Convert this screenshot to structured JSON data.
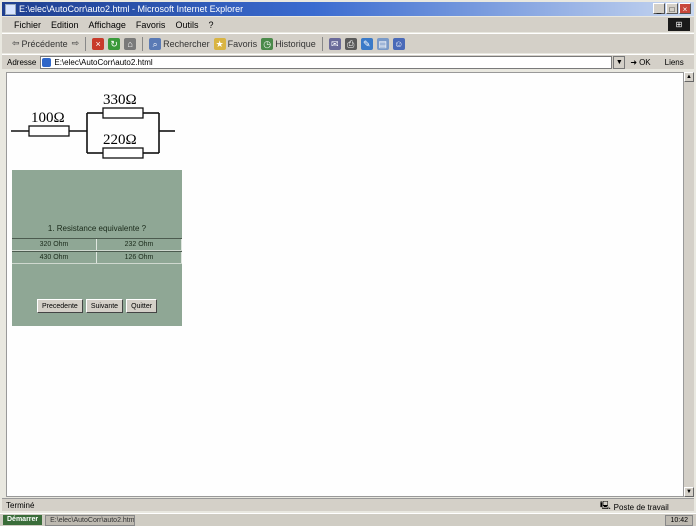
{
  "window": {
    "title": "E:\\elec\\AutoCorr\\auto2.html - Microsoft Internet Explorer",
    "controls": [
      "_",
      "□",
      "×"
    ]
  },
  "menu": {
    "items": [
      "Fichier",
      "Edition",
      "Affichage",
      "Favoris",
      "Outils",
      "?"
    ]
  },
  "toolbar": {
    "back": "Précédente",
    "search": "Rechercher",
    "favorites": "Favoris",
    "history": "Historique"
  },
  "address": {
    "label": "Adresse",
    "url": "E:\\elec\\AutoCorr\\auto2.html",
    "go": "OK",
    "links": "Liens"
  },
  "circuit": {
    "r1": "100Ω",
    "r2": "330Ω",
    "r3": "220Ω"
  },
  "quiz": {
    "question": "1. Resistance equivalente ?",
    "answers": [
      [
        "320 Ohm",
        "232 Ohm"
      ],
      [
        "430 Ohm",
        "126 Ohm"
      ]
    ],
    "buttons": {
      "prev": "Precedente",
      "next": "Suivante",
      "quit": "Quitter"
    }
  },
  "status": {
    "text": "Terminé",
    "zone": "Poste de travail"
  },
  "taskbar": {
    "start": "Démarrer",
    "tasks": [
      "E:\\elec\\AutoCorr\\auto2.html"
    ],
    "tray": "10:42"
  },
  "colors": {
    "quiz_bg": "#8fa795",
    "title_bar": "#1f3f8f"
  }
}
